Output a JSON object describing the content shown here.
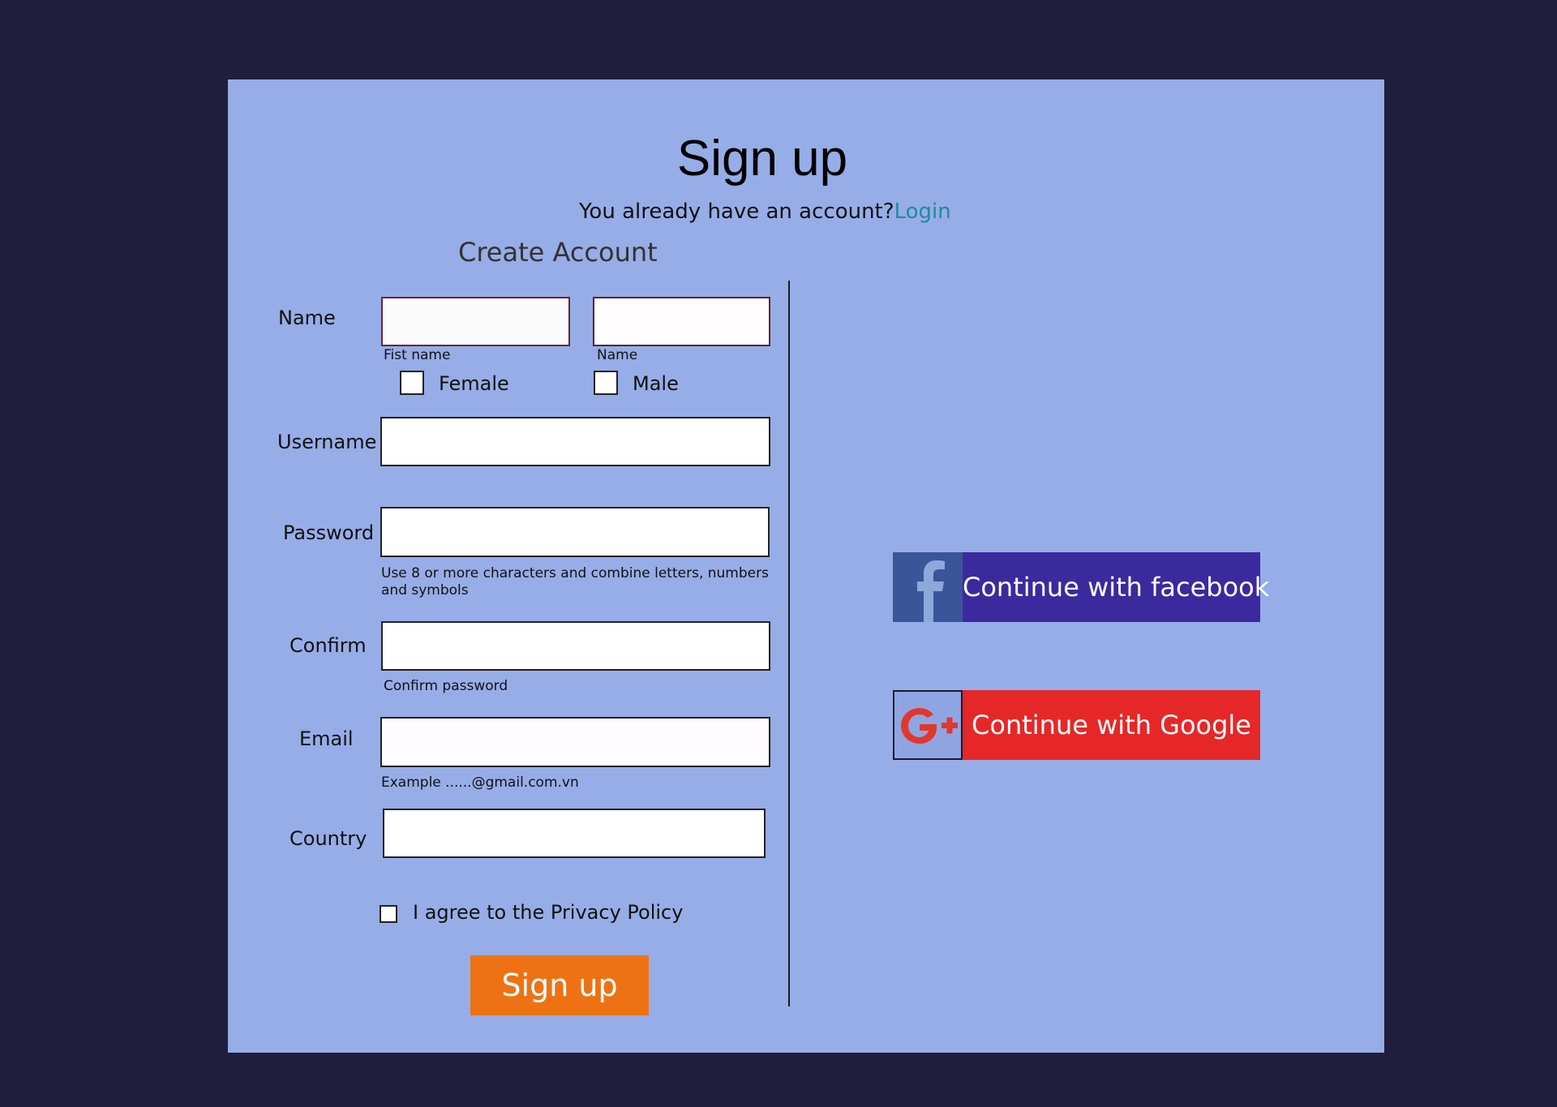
{
  "header": {
    "title": "Sign up",
    "have_account_text": "You already have an account?",
    "login_link": "Login",
    "subtitle": "Create Account"
  },
  "form": {
    "name_label": "Name",
    "first_name_hint": "Fist name",
    "last_name_hint": "Name",
    "gender": {
      "female_label": "Female",
      "male_label": "Male",
      "female_checked": false,
      "male_checked": false
    },
    "username_label": "Username",
    "password_label": "Password",
    "password_hint": "Use 8 or more characters and combine letters, numbers and symbols",
    "confirm_label": "Confirm",
    "confirm_hint": "Confirm password",
    "email_label": "Email",
    "email_hint": "Example ......@gmail.com.vn",
    "country_label": "Country",
    "agree_label": "I agree to the Privacy Policy",
    "agree_checked": false,
    "submit_label": "Sign up",
    "values": {
      "first_name": "",
      "last_name": "",
      "username": "",
      "password": "",
      "confirm": "",
      "email": "",
      "country": ""
    }
  },
  "social": {
    "facebook": {
      "label": "Continue with facebook",
      "icon": "facebook-icon"
    },
    "google": {
      "label": "Continue with Google",
      "icon": "google-plus-icon"
    }
  },
  "colors": {
    "background": "#1f1e3d",
    "card": "#97ade7",
    "link": "#1f8c9a",
    "signup_button": "#ee7214",
    "facebook_button": "#3b2a9e",
    "facebook_icon_bg": "#3b5599",
    "google_button": "#e52728"
  }
}
